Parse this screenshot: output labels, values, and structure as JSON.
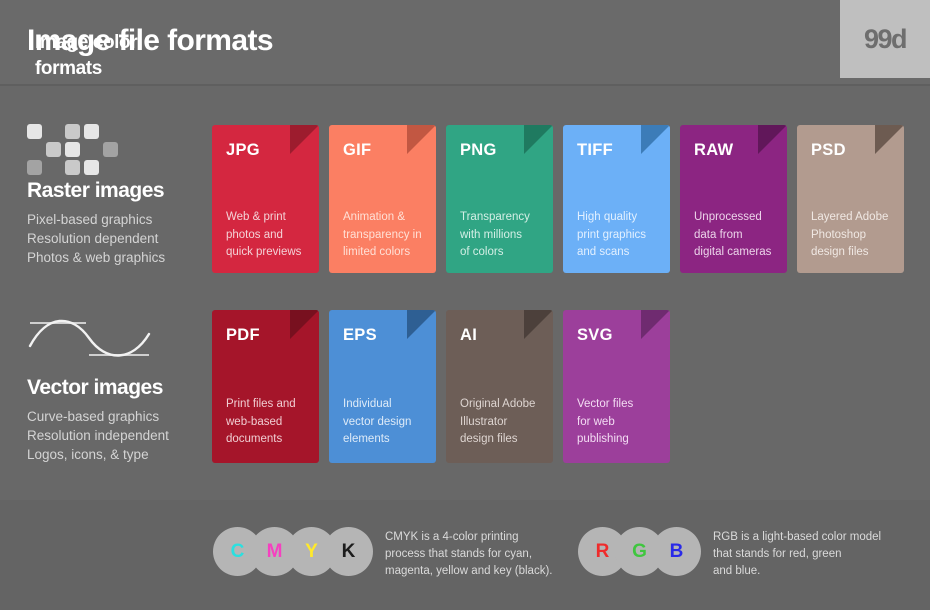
{
  "header": {
    "title": "Image file formats",
    "logo": "99d"
  },
  "sections": [
    {
      "key": "raster",
      "title": "Raster images",
      "lines": [
        "Pixel-based graphics",
        "Resolution dependent",
        "Photos & web graphics"
      ],
      "icon": "pixel-grid-icon"
    },
    {
      "key": "vector",
      "title": "Vector images",
      "lines": [
        "Curve-based graphics",
        "Resolution independent",
        "Logos, icons, & type"
      ],
      "icon": "bezier-curve-icon"
    }
  ],
  "raster_formats": [
    {
      "abbr": "JPG",
      "desc": [
        "Web & print",
        "photos and",
        "quick previews"
      ],
      "color": "#d42740",
      "fold": "#9d1c2e",
      "label_color": "#ffffff",
      "text_color": "#f4d2d7"
    },
    {
      "abbr": "GIF",
      "desc": [
        "Animation &",
        "transparency in",
        "limited colors"
      ],
      "color": "#fb7f63",
      "fold": "#c25742",
      "label_color": "#ffffff",
      "text_color": "#ffe0d6"
    },
    {
      "abbr": "PNG",
      "desc": [
        "Transparency",
        "with millions",
        "of colors"
      ],
      "color": "#30a584",
      "fold": "#1f7a60",
      "label_color": "#ffffff",
      "text_color": "#d4efe6"
    },
    {
      "abbr": "TIFF",
      "desc": [
        "High quality",
        "print graphics",
        "and scans"
      ],
      "color": "#6cb0f7",
      "fold": "#3c7cb8",
      "label_color": "#ffffff",
      "text_color": "#e2f0ff"
    },
    {
      "abbr": "RAW",
      "desc": [
        "Unprocessed",
        "data from",
        "digital cameras"
      ],
      "color": "#8c2582",
      "fold": "#61175a",
      "label_color": "#ffffff",
      "text_color": "#ecd4ea"
    },
    {
      "abbr": "PSD",
      "desc": [
        "Layered Adobe",
        "Photoshop",
        "design files"
      ],
      "color": "#b29b8f",
      "fold": "#6d5b51",
      "label_color": "#ffffff",
      "text_color": "#f0e8e3"
    }
  ],
  "vector_formats": [
    {
      "abbr": "PDF",
      "desc": [
        "Print files and",
        "web-based",
        "documents"
      ],
      "color": "#a5152a",
      "fold": "#78101f",
      "label_color": "#ffffff",
      "text_color": "#f0cdd2"
    },
    {
      "abbr": "EPS",
      "desc": [
        "Individual",
        "vector design",
        "elements"
      ],
      "color": "#4d8fd6",
      "fold": "#2e5f93",
      "label_color": "#ffffff",
      "text_color": "#deebf8"
    },
    {
      "abbr": "AI",
      "desc": [
        "Original Adobe",
        "Illustrator",
        "design files"
      ],
      "color": "#6d5e57",
      "fold": "#4c403b",
      "label_color": "#ffffff",
      "text_color": "#ded5d1"
    },
    {
      "abbr": "SVG",
      "desc": [
        "Vector files",
        "for web",
        "publishing"
      ],
      "color": "#9c3f9b",
      "fold": "#6f2b70",
      "label_color": "#ffffff",
      "text_color": "#f3dcf3"
    }
  ],
  "footer": {
    "title_line1": "Image color",
    "title_line2": "formats",
    "cmyk": {
      "letters": [
        {
          "letter": "C",
          "color": "#2ae0e0"
        },
        {
          "letter": "M",
          "color": "#f540c0"
        },
        {
          "letter": "Y",
          "color": "#ffe92b"
        },
        {
          "letter": "K",
          "color": "#1c1c1c"
        }
      ],
      "blurb": [
        "CMYK is a 4-color printing",
        "process that stands for cyan,",
        "magenta, yellow and key (black)."
      ]
    },
    "rgb": {
      "letters": [
        {
          "letter": "R",
          "color": "#ef2b2b"
        },
        {
          "letter": "G",
          "color": "#3fc63f"
        },
        {
          "letter": "B",
          "color": "#2a2ae8"
        }
      ],
      "blurb": [
        "RGB is a light-based color model",
        "that stands for red, green",
        "and blue."
      ]
    }
  }
}
